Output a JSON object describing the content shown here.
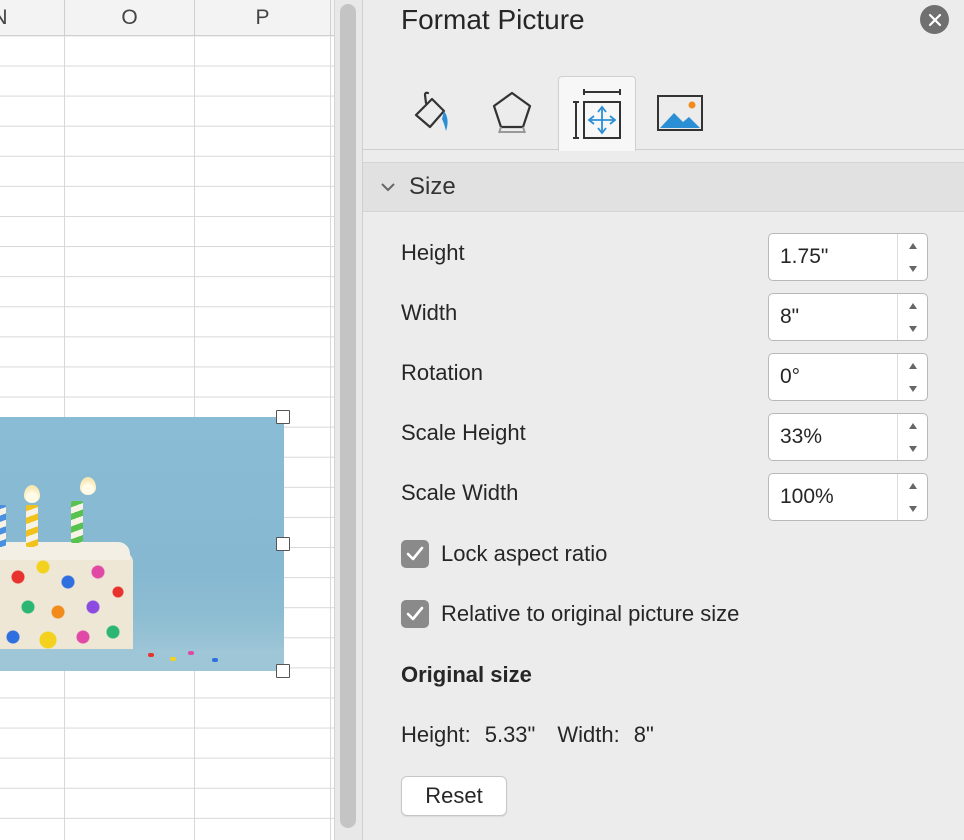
{
  "sheet": {
    "columns": [
      {
        "label": "N"
      },
      {
        "label": "O"
      },
      {
        "label": "P"
      }
    ]
  },
  "pane": {
    "title": "Format Picture",
    "tabs": [
      {
        "icon": "fill-line-icon",
        "active": false
      },
      {
        "icon": "effects-pentagon-icon",
        "active": false
      },
      {
        "icon": "size-properties-icon",
        "active": true
      },
      {
        "icon": "picture-icon",
        "active": false
      }
    ],
    "section": {
      "title": "Size",
      "expanded": true
    },
    "fields": {
      "height": {
        "label": "Height",
        "value": "1.75\""
      },
      "width": {
        "label": "Width",
        "value": "8\""
      },
      "rotation": {
        "label": "Rotation",
        "value": "0°"
      },
      "scale_height": {
        "label": "Scale Height",
        "value": "33%"
      },
      "scale_width": {
        "label": "Scale Width",
        "value": "100%"
      }
    },
    "checkboxes": {
      "lock_aspect": {
        "label": "Lock aspect ratio",
        "checked": true
      },
      "relative_original": {
        "label": "Relative to original picture size",
        "checked": true
      }
    },
    "original_size": {
      "title": "Original size",
      "height_label": "Height:",
      "height_value": "5.33\"",
      "width_label": "Width:",
      "width_value": "8\""
    },
    "reset_label": "Reset"
  },
  "colors": {
    "accent_blue": "#2b8fd6",
    "pane_background": "#ececec",
    "checkbox_fill": "#8a8a8a"
  }
}
